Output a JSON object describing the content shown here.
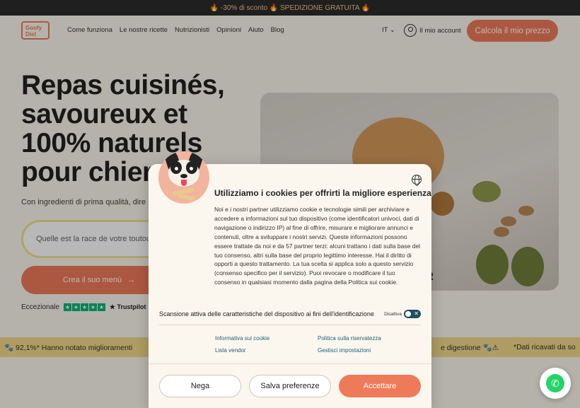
{
  "promo_text": "🔥 -30% di sconto 🔥 SPEDIZIONE GRATUITA 🔥",
  "nav": {
    "logo": "Goofy Diet",
    "items": [
      "Come funziona",
      "Le nostre ricette",
      "Nutrizionisti",
      "Opinioni",
      "Aiuto",
      "Blog"
    ],
    "lang": "IT ⌄",
    "account": "Il mio account",
    "cta": "Calcola il mio prezzo"
  },
  "hero": {
    "title": "Repas cuisinés, savoureux et 100% naturels pour chien",
    "subtitle": "Con ingredienti di prima qualità, dire",
    "search_placeholder": "Quelle est la race de votre toutou",
    "cta": "Crea il suo menù",
    "cta_arrow": "→",
    "rating_label": "Eccezionale",
    "trustpilot": "★ Trustpilot",
    "image_text": "UR"
  },
  "strip": {
    "left": "🐾   92,1%* Hanno notato miglioramenti",
    "right": "e digestione 🐾⚠",
    "right2": "*Dati ricavati da so"
  },
  "cookie": {
    "title": "Utilizziamo i cookies per offrirti la migliore esperienza",
    "body": "Noi e i nostri partner utilizziamo cookie e tecnologie simili per archiviare e accedere a informazioni sul tuo dispositivo (come identificatori univoci, dati di navigazione o indirizzo IP) al fine di offrire, misurare e migliorare annunci e contenuti, oltre a sviluppare i nostri servizi. Queste informazioni possono essere trattate da noi e da 57 partner terzi: alcuni trattano i dati sulla base del tuo consenso, altri sulla base del proprio legittimo interesse. Hai il diritto di opporti a questo trattamento. La tua scelta si applica solo a questo servizio (consenso specifico per il servizio). Puoi revocare o modificare il tuo consenso in qualsiasi momento dalla pagina della Politica sui cookie.",
    "scan_label": "Scansione attiva delle caratteristiche del dispositivo ai fini dell'identificazione",
    "toggle_state": "Disattiva",
    "toggle_symbol": "✕",
    "links": {
      "cookie_policy": "Informativa sui cookie",
      "privacy_policy": "Politica sulla riservatezza",
      "vendor_list": "Lista vendor",
      "manage_settings": "Gestisci impostazioni"
    },
    "buttons": {
      "deny": "Nega",
      "save": "Salva preferenze",
      "accept": "Accettare"
    }
  },
  "whatsapp_icon": "✆",
  "colors": {
    "accent": "#ef7a5a",
    "promo_bg": "#2b2b2b",
    "strip_bg": "#f2d98a",
    "page_bg": "#fbf7ee",
    "link": "#1f5f7a",
    "toggle": "#1f4e5f",
    "trustpilot": "#00b67a"
  },
  "icons": [
    "user-icon",
    "globe-icon",
    "arrow-right-icon",
    "chevron-down-icon",
    "whatsapp-icon",
    "dog-mascot"
  ]
}
